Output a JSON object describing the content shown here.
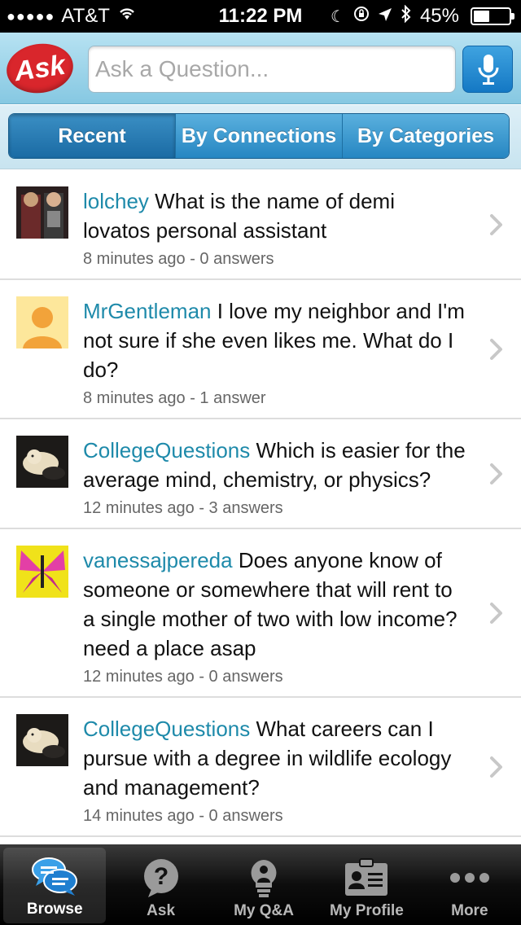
{
  "status_bar": {
    "carrier": "AT&T",
    "time": "11:22 PM",
    "battery_percent": "45%",
    "battery_level": 0.45,
    "icons": [
      "signal-dots-icon",
      "wifi-icon",
      "moon-icon",
      "orientation-lock-icon",
      "location-icon",
      "bluetooth-icon",
      "battery-icon"
    ]
  },
  "header": {
    "logo_text": "Ask",
    "search_placeholder": "Ask a Question...",
    "mic_icon": "microphone-icon"
  },
  "segments": [
    {
      "label": "Recent",
      "active": true
    },
    {
      "label": "By Connections",
      "active": false
    },
    {
      "label": "By Categories",
      "active": false
    }
  ],
  "questions": [
    {
      "user": "lolchey",
      "text": "What is the name of demi lovatos personal assistant",
      "meta": "8 minutes ago - 0 answers"
    },
    {
      "user": "MrGentleman",
      "text": " I love my neighbor and I'm not sure if she even likes me. What do I do?",
      "meta": "8 minutes ago - 1 answer"
    },
    {
      "user": "CollegeQuestions",
      "text": "Which is easier for the average mind, chemistry, or physics?",
      "meta": "12 minutes ago - 3 answers"
    },
    {
      "user": "vanessajpereda",
      "text": "Does anyone know of someone or somewhere that will rent to a single mother of two with low income? need a place asap",
      "meta": "12 minutes ago - 0 answers"
    },
    {
      "user": "CollegeQuestions",
      "text": "What careers can I pursue with a degree in wildlife ecology and management?",
      "meta": "14 minutes ago - 0 answers"
    }
  ],
  "tabs": [
    {
      "label": "Browse",
      "icon": "speech-bubbles-icon",
      "active": true
    },
    {
      "label": "Ask",
      "icon": "question-bubble-icon",
      "active": false
    },
    {
      "label": "My Q&A",
      "icon": "lightbulb-person-icon",
      "active": false
    },
    {
      "label": "My Profile",
      "icon": "profile-card-icon",
      "active": false
    },
    {
      "label": "More",
      "icon": "more-dots-icon",
      "active": false
    }
  ],
  "colors": {
    "username": "#1e8aaa",
    "segment_blue": "#2686c2",
    "logo_red": "#d9262c"
  }
}
